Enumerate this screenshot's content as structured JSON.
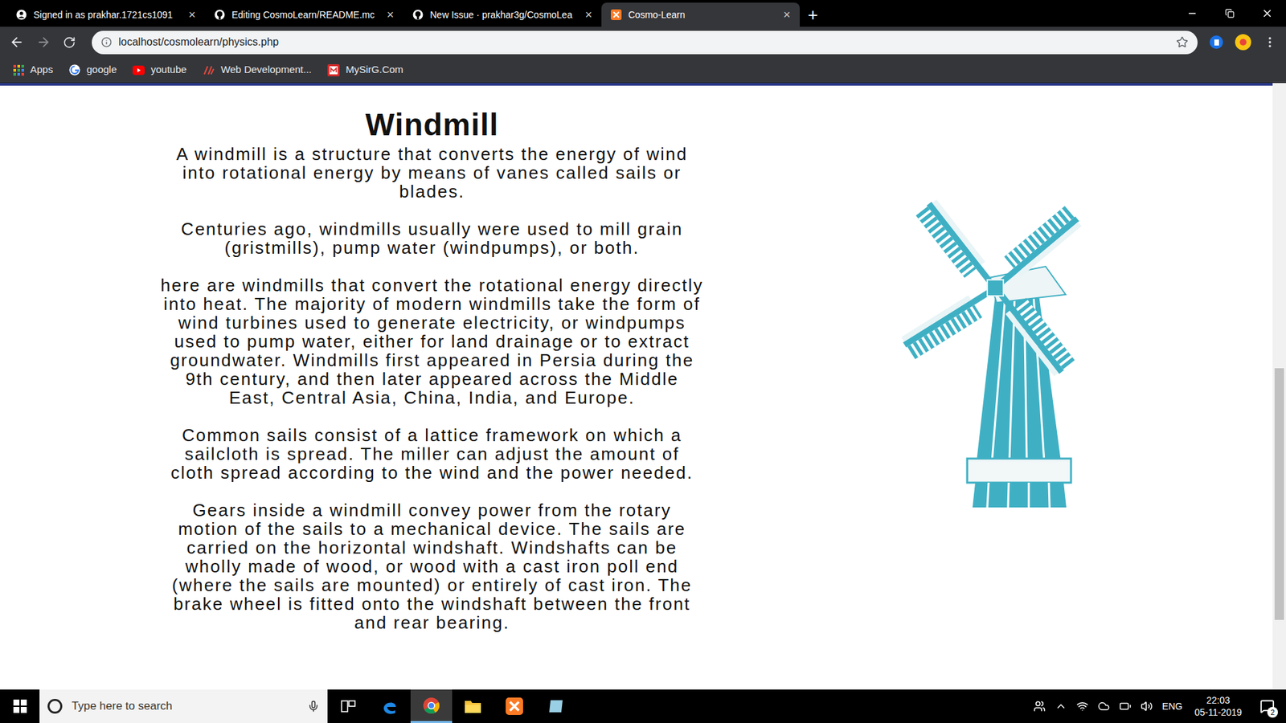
{
  "browser": {
    "tabs": [
      {
        "title": "Signed in as prakhar.1721cs1091",
        "selected": false,
        "kind": "account"
      },
      {
        "title": "Editing CosmoLearn/README.mc",
        "selected": false,
        "kind": "github"
      },
      {
        "title": "New Issue · prakhar3g/CosmoLea",
        "selected": false,
        "kind": "github"
      },
      {
        "title": "Cosmo-Learn",
        "selected": true,
        "kind": "xampp"
      }
    ],
    "tab_close": "×",
    "new_tab": "+",
    "address": "localhost/cosmolearn/physics.php",
    "bookmarks": [
      {
        "label": "Apps",
        "kind": "apps"
      },
      {
        "label": "google",
        "kind": "google"
      },
      {
        "label": "youtube",
        "kind": "youtube"
      },
      {
        "label": "Web Development...",
        "kind": "webdev"
      },
      {
        "label": "MySirG.Com",
        "kind": "mysirg"
      }
    ]
  },
  "page": {
    "title": "Windmill",
    "paragraphs": [
      "A windmill is a structure that converts the energy of wind into rotational energy by means of vanes called sails or blades.",
      "Centuries ago, windmills usually were used to mill grain (gristmills), pump water (windpumps), or both.",
      "here are windmills that convert the rotational energy directly into heat. The majority of modern windmills take the form of wind turbines used to generate electricity, or windpumps used to pump water, either for land drainage or to extract groundwater. Windmills first appeared in Persia during the 9th century, and then later appeared across the Middle East, Central Asia, China, India, and Europe.",
      "Common sails consist of a lattice framework on which a sailcloth is spread. The miller can adjust the amount of cloth spread according to the wind and the power needed.",
      "Gears inside a windmill convey power from the rotary motion of the sails to a mechanical device. The sails are carried on the horizontal windshaft. Windshafts can be wholly made of wood, or wood with a cast iron poll end (where the sails are mounted) or entirely of cast iron. The brake wheel is fitted onto the windshaft between the front and rear bearing."
    ],
    "scrollbar": {
      "thumb_start": 0.47,
      "thumb_size": 0.415
    }
  },
  "taskbar": {
    "search_placeholder": "Type here to search",
    "language": "ENG",
    "time": "22:03",
    "date": "05-11-2019",
    "notifications": "2"
  }
}
